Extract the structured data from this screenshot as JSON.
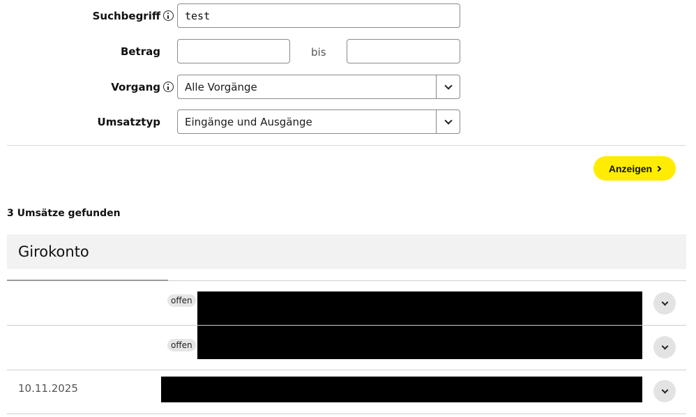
{
  "filter": {
    "search_label": "Suchbegriff",
    "search_value": "test",
    "amount_label": "Betrag",
    "amount_from": "",
    "amount_separator": "bis",
    "amount_to": "",
    "process_label": "Vorgang",
    "process_value": "Alle Vorgänge",
    "type_label": "Umsatztyp",
    "type_value": "Eingänge und Ausgänge",
    "submit_label": "Anzeigen"
  },
  "results": {
    "count_text": "3 Umsätze gefunden",
    "account_title": "Girokonto",
    "transactions": [
      {
        "status": "offen",
        "date": ""
      },
      {
        "status": "offen",
        "date": ""
      },
      {
        "status": "",
        "date": "10.11.2025"
      }
    ]
  },
  "colors": {
    "accent": "#ffec00",
    "account_header_bg": "#f1f2f1",
    "badge_bg": "#e6e6e6"
  }
}
